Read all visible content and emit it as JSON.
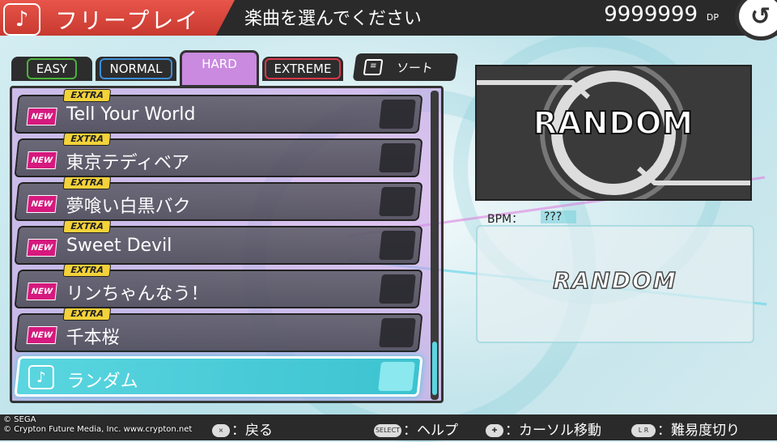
{
  "header": {
    "title": "フリープレイ",
    "subtitle": "楽曲を選んでください",
    "dp_value": "9999999",
    "dp_unit": "DP"
  },
  "tabs": [
    {
      "label": "EASY",
      "color": "#4bb33c"
    },
    {
      "label": "NORMAL",
      "color": "#3c8fd8"
    },
    {
      "label": "HARD",
      "color": "#c98ae0",
      "selected": true
    },
    {
      "label": "EXTREME",
      "color": "#d8384a"
    }
  ],
  "sort": {
    "label": "ソート"
  },
  "songs": [
    {
      "title": "Tell Your World",
      "badge": "NEW",
      "tag": "EXTRA"
    },
    {
      "title": "東京テディベア",
      "badge": "NEW",
      "tag": "EXTRA"
    },
    {
      "title": "夢喰い白黒バク",
      "badge": "NEW",
      "tag": "EXTRA"
    },
    {
      "title": "Sweet Devil",
      "badge": "NEW",
      "tag": "EXTRA"
    },
    {
      "title": "リンちゃんなう！",
      "badge": "NEW",
      "tag": "EXTRA"
    },
    {
      "title": "千本桜",
      "badge": "NEW",
      "tag": "EXTRA"
    }
  ],
  "random_item": {
    "title": "ランダム",
    "selected": true
  },
  "jacket": {
    "text": "RANDOM"
  },
  "details": {
    "bpm_label": "BPM：",
    "bpm_value": "???",
    "info_text": "RANDOM"
  },
  "footer": {
    "hint_back": "：戻る",
    "hint_help": "：ヘルプ",
    "hint_cursor": "：カーソル移動",
    "hint_difficulty": "：難易度切り",
    "select_label": "SELECT",
    "lr_label": "L R"
  },
  "copyright": {
    "line1": "© SEGA",
    "line2": "© Crypton Future Media, Inc. www.crypton.net"
  }
}
